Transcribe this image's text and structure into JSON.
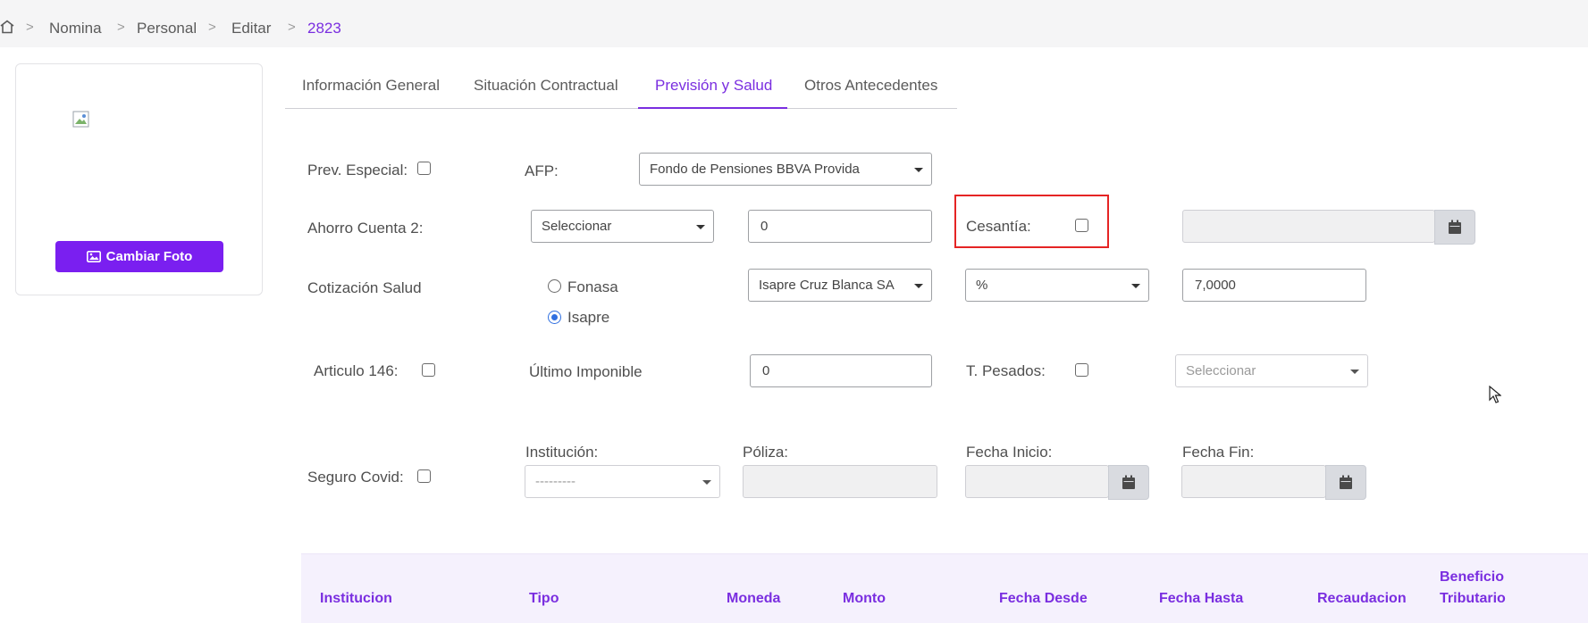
{
  "breadcrumb": {
    "home_icon": "home-icon",
    "items": [
      "Nomina",
      "Personal",
      "Editar",
      "2823"
    ],
    "separator": ">"
  },
  "photo": {
    "button_label": "Cambiar Foto",
    "button_icon": "image-icon"
  },
  "tabs": [
    {
      "label": "Información General",
      "active": false
    },
    {
      "label": "Situación Contractual",
      "active": false
    },
    {
      "label": "Previsión y Salud",
      "active": true
    },
    {
      "label": "Otros Antecedentes",
      "active": false
    }
  ],
  "form": {
    "prev_especial_label": "Prev. Especial:",
    "afp_label": "AFP:",
    "afp_value": "Fondo de Pensiones BBVA Provida",
    "ahorro_label": "Ahorro Cuenta 2:",
    "ahorro_select": "Seleccionar",
    "ahorro_amount": "0",
    "cesantia_label": "Cesantía:",
    "cotizacion_label": "Cotización Salud",
    "fonasa_label": "Fonasa",
    "isapre_label": "Isapre",
    "isapre_selected": true,
    "isapre_institution": "Isapre Cruz Blanca SA",
    "unit_select": "%",
    "cotizacion_value": "7,0000",
    "articulo_label": "Articulo 146:",
    "ultimo_label": "Último Imponible",
    "ultimo_value": "0",
    "t_pesados_label": "T. Pesados:",
    "t_pesados_select": "Seleccionar",
    "seguro_label": "Seguro Covid:",
    "institucion_label": "Institución:",
    "institucion_value": "---------",
    "poliza_label": "Póliza:",
    "fecha_inicio_label": "Fecha Inicio:",
    "fecha_fin_label": "Fecha Fin:"
  },
  "table": {
    "headers": [
      "Institucion",
      "Tipo",
      "Moneda",
      "Monto",
      "Fecha Desde",
      "Fecha Hasta",
      "Recaudacion",
      "Beneficio Tributario"
    ]
  },
  "colors": {
    "accent": "#7a2ee0",
    "button": "#7a1ff0",
    "highlight": "#e52424"
  }
}
